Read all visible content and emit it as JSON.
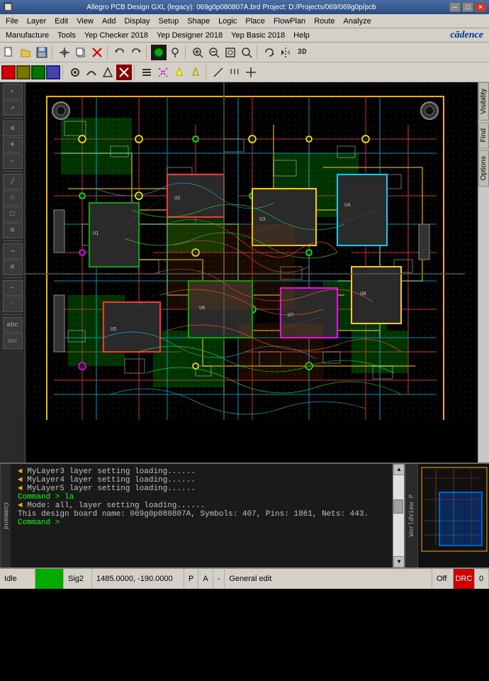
{
  "titlebar": {
    "title": "Allegro PCB Design GXL (legacy): 069g0p080807A.brd  Project: D:/Projects/069/069g0p/pcb",
    "minimize_label": "─",
    "maximize_label": "□",
    "close_label": "✕"
  },
  "menubar": {
    "items": [
      "File",
      "Layer",
      "Edit",
      "View",
      "Add",
      "Display",
      "Setup",
      "Shape",
      "Logic",
      "Place",
      "FlowPlan",
      "Route",
      "Analyze"
    ]
  },
  "menubar2": {
    "items": [
      "Manufacture",
      "Tools",
      "Yep Checker 2018",
      "Yep Designer 2018",
      "Yep Basic 2018",
      "Help"
    ],
    "logo": "cādence"
  },
  "right_sidebar": {
    "tabs": [
      "Visibility",
      "Find",
      "Options"
    ]
  },
  "console": {
    "lines": [
      {
        "prefix": "◄",
        "text": "MyLayer3 layer setting loading......",
        "type": "arrow"
      },
      {
        "prefix": "◄",
        "text": "MyLayer4 layer setting loading......",
        "type": "arrow"
      },
      {
        "prefix": "◄",
        "text": "MyLayer5 layer setting loading......",
        "type": "arrow"
      },
      {
        "prefix": "",
        "text": "Command > la",
        "type": "cmd"
      },
      {
        "prefix": "◄",
        "text": "Mode: all, layer setting loading......",
        "type": "arrow"
      },
      {
        "prefix": "",
        "text": "This design board name: 069g0p080807A, Symbols: 407, Pins: 1861, Nets: 443.",
        "type": "info"
      },
      {
        "prefix": "",
        "text": "Command >",
        "type": "cmd"
      }
    ],
    "cmd_label": "Command"
  },
  "worldview": {
    "label": "WorldView P"
  },
  "statusbar": {
    "idle": "Idle",
    "signal": "Sig2",
    "coords": "1485.0000, -190.0000",
    "pa_label": "P",
    "pa_label2": "A",
    "mode": "General edit",
    "off_label": "Off",
    "num": "0"
  }
}
